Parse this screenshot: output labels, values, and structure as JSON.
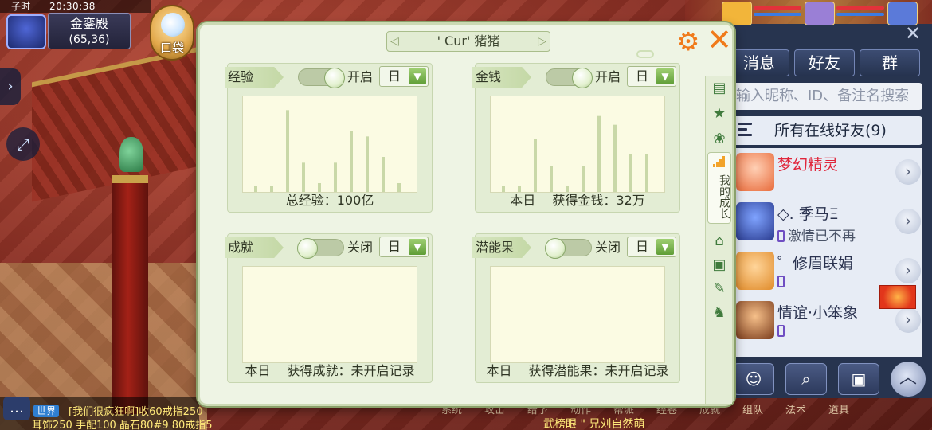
{
  "hud": {
    "period": "子时",
    "clock": "20:30:38",
    "location_name": "金銮殿",
    "location_coords": "(65,36)",
    "bag_label": "口袋"
  },
  "chat": {
    "channel": "世界",
    "line1": "[我们很疯狂啊]收60戒指250",
    "line2": "耳饰250 手配100 晶石80#9 80戒指5"
  },
  "bottom_menu": [
    "系统",
    "攻击",
    "给予",
    "动作",
    "帮派",
    "经卷",
    "成就",
    "组队",
    "法术",
    "道具"
  ],
  "bottom_caption": "武榜眼  \" 兄刘自然萌",
  "dialog": {
    "title": "' Cur' 猪猪",
    "side_tabs": {
      "growth_label": "我的成长",
      "icons": [
        "chat-icon",
        "star-icon",
        "paw-icon",
        "growth-icon",
        "house-icon",
        "shop-icon",
        "palette-icon",
        "shirt-icon"
      ]
    },
    "cards": [
      {
        "title": "经验",
        "toggle_state": "开启",
        "period": "日",
        "footer": [
          "总经验：100亿"
        ],
        "chart": [
          2,
          2,
          28,
          10,
          3,
          10,
          21,
          19,
          12,
          3
        ]
      },
      {
        "title": "金钱",
        "toggle_state": "开启",
        "period": "日",
        "footer": [
          "本日",
          "获得金钱：32万"
        ],
        "chart": [
          2,
          2,
          18,
          9,
          2,
          9,
          26,
          23,
          13,
          13
        ]
      },
      {
        "title": "成就",
        "toggle_state": "关闭",
        "period": "日",
        "footer": [
          "本日",
          "获得成就：未开启记录"
        ],
        "chart": []
      },
      {
        "title": "潜能果",
        "toggle_state": "关闭",
        "period": "日",
        "footer": [
          "本日",
          "获得潜能果：未开启记录"
        ],
        "chart": []
      }
    ],
    "colors": {
      "accent": "#f07a1a",
      "panel": "#eef4e4",
      "bar": "#c9d8a8"
    }
  },
  "friends": {
    "tabs": [
      "消息",
      "好友",
      "群"
    ],
    "search_placeholder": "输入昵称、ID、备注名搜索",
    "group_label": "所有在线好友(9)",
    "list": [
      {
        "name": "梦幻精灵",
        "status": "",
        "name_color": "#e0263b",
        "has_phone": false
      },
      {
        "name": "◇. 季马Ξ",
        "status": "激情已不再",
        "name_color": "#2b3350",
        "has_phone": true
      },
      {
        "name": "゜修眉联娟",
        "status": "",
        "name_color": "#2b3350",
        "has_phone": true
      },
      {
        "name": "情谊·小笨象",
        "status": "",
        "name_color": "#2b3350",
        "has_phone": true
      }
    ]
  }
}
